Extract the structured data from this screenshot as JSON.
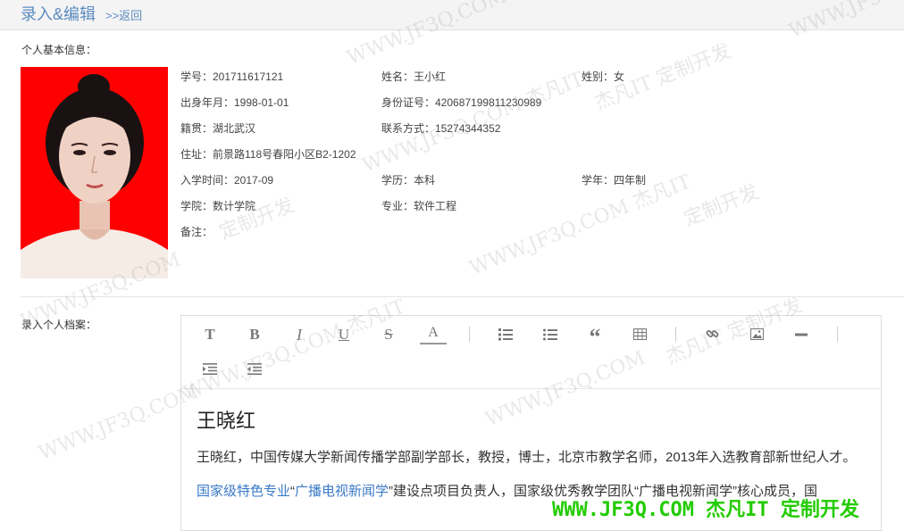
{
  "header": {
    "title": "录入&编辑",
    "back_label": ">>返回"
  },
  "basic_info": {
    "section_label": "个人基本信息：",
    "student_id": "学号：201711617121",
    "name": "姓名：王小红",
    "gender": "姓别：女",
    "birth": "出身年月：1998-01-01",
    "id_card": "身份证号：420687199811230989",
    "native_place": "籍贯：湖北武汉",
    "contact": "联系方式：15274344352",
    "address": "住址：前景路118号春阳小区B2-1202",
    "enroll_time": "入学时间：2017-09",
    "education": "学历：本科",
    "school_years": "学年：四年制",
    "college": "学院：数计学院",
    "major": "专业：软件工程",
    "remark": "备注："
  },
  "archive": {
    "section_label": "录入个人档案：",
    "toolbar": {
      "title": "T",
      "bold": "B",
      "italic": "I",
      "underline": "U",
      "strike": "S",
      "color": "A",
      "quote": "“"
    },
    "heading": "王晓红",
    "paragraph1": "王晓红，中国传媒大学新闻传播学部副学部长，教授，博士，北京市教学名师，2013年入选教育部新世纪人才。",
    "p2_link1": "国家级特色专业",
    "p2_q1": "“",
    "p2_link2": "广播电视新闻学",
    "p2_rest": "”建设点项目负责人，国家级优秀教学团队“广播电视新闻学”核心成员，国"
  },
  "watermark": {
    "site": "WWW.JF3Q.COM",
    "site_brand": "WWW.JF3Q.COM 杰凡IT",
    "brand_custom": "杰凡IT  定制开发",
    "custom": "定制开发"
  },
  "footer_brand": "WWW.JF3Q.COM 杰凡IT  定制开发",
  "colors": {
    "photo_bg": "#ff0000",
    "link": "#5b8bbf",
    "brand": "#22cc00"
  }
}
